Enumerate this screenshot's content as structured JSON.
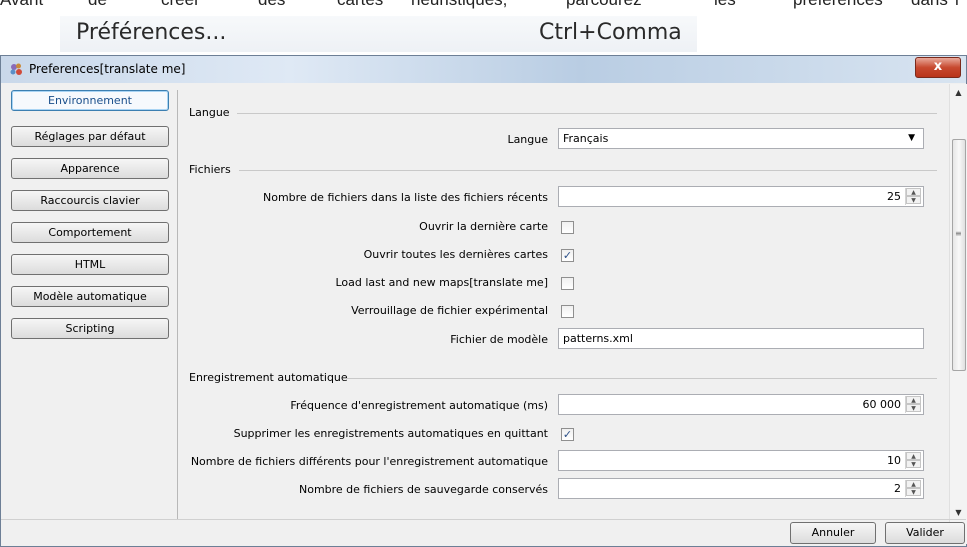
{
  "top_text": [
    "Avant",
    "de",
    "créer",
    "des",
    "cartes",
    "heuristiques,",
    "parcourez",
    "les",
    "préférences",
    "dans",
    "l'"
  ],
  "menu": {
    "item_label": "Préférences...",
    "shortcut": "Ctrl+Comma"
  },
  "window": {
    "title": "Preferences[translate me]",
    "close_glyph": "x"
  },
  "tabs": [
    {
      "label": "Environnement",
      "active": true
    },
    {
      "label": "Réglages par défaut"
    },
    {
      "label": "Apparence"
    },
    {
      "label": "Raccourcis clavier"
    },
    {
      "label": "Comportement"
    },
    {
      "label": "HTML"
    },
    {
      "label": "Modèle automatique"
    },
    {
      "label": "Scripting"
    }
  ],
  "sections": {
    "langue": {
      "title": "Langue",
      "language_label": "Langue",
      "language_value": "Français"
    },
    "fichiers": {
      "title": "Fichiers",
      "recent_count_label": "Nombre de fichiers dans la liste des fichiers récents",
      "recent_count_value": "25",
      "open_last_map_label": "Ouvrir la dernière carte",
      "open_last_map_checked": false,
      "open_all_last_label": "Ouvrir toutes les dernières cartes",
      "open_all_last_checked": true,
      "load_last_new_label": "Load last and new maps[translate me]",
      "load_last_new_checked": false,
      "experimental_lock_label": "Verrouillage de fichier expérimental",
      "experimental_lock_checked": false,
      "template_file_label": "Fichier de modèle",
      "template_file_value": "patterns.xml"
    },
    "autosave": {
      "title": "Enregistrement automatique",
      "frequency_label": "Fréquence d'enregistrement automatique (ms)",
      "frequency_value": "60 000",
      "delete_on_quit_label": "Supprimer les enregistrements automatiques en quittant",
      "delete_on_quit_checked": true,
      "distinct_files_label": "Nombre de fichiers différents pour l'enregistrement automatique",
      "distinct_files_value": "10",
      "backups_kept_label": "Nombre de fichiers de sauvegarde conservés",
      "backups_kept_value": "2"
    }
  },
  "buttons": {
    "cancel": "Annuler",
    "ok": "Valider"
  },
  "icons": {
    "checkmark": "✓",
    "combo_arrow": "▼",
    "spin_up": "▲",
    "spin_down": "▼",
    "scroll_up": "▲",
    "scroll_down": "▼",
    "scroll_grip": "≡"
  }
}
